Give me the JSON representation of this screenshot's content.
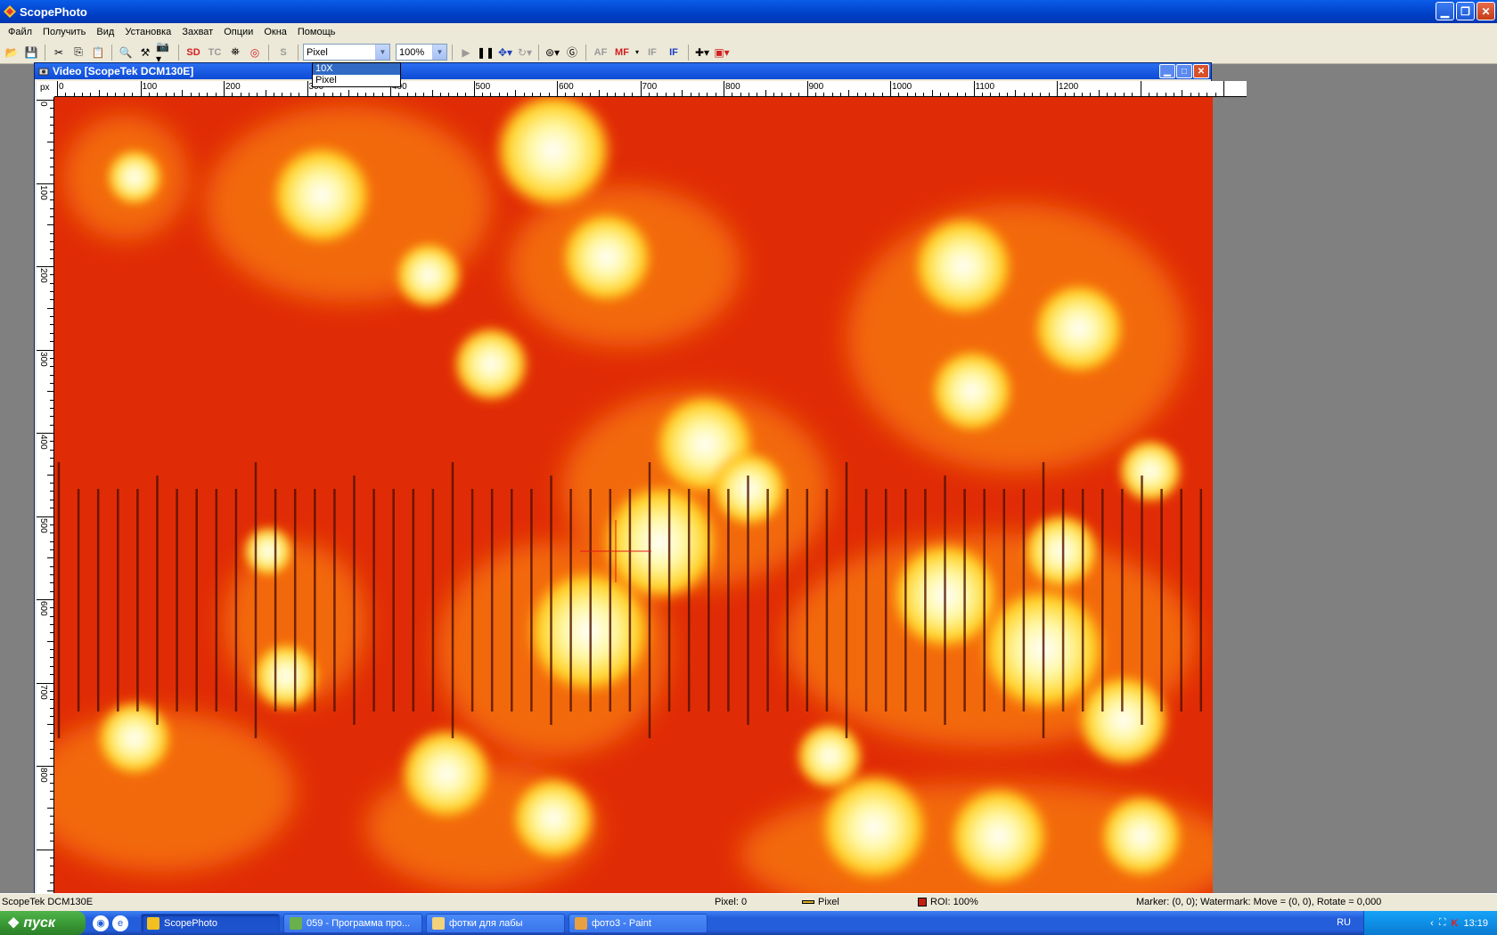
{
  "app": {
    "title": "ScopePhoto"
  },
  "menu": [
    "Файл",
    "Получить",
    "Вид",
    "Установка",
    "Захват",
    "Опции",
    "Окна",
    "Помощь"
  ],
  "toolbar": {
    "sd_label": "SD",
    "tc_label": "TC",
    "s_label": "S",
    "af_label": "AF",
    "mf_label": "MF",
    "if1_label": "IF",
    "if2_label": "IF",
    "units_value": "Pixel",
    "zoom_value": "100%"
  },
  "dropdown": {
    "options": [
      "10X",
      "Pixel"
    ],
    "selected_index": 0
  },
  "child_window": {
    "title": "Video [ScopeTek DCM130E]",
    "ruler_unit": "px",
    "ruler_top_ticks": [
      "0",
      "100",
      "200",
      "300",
      "400",
      "500",
      "600",
      "700",
      "800",
      "900",
      "1000",
      "1100",
      "1200"
    ],
    "ruler_left_ticks": [
      "0",
      "100",
      "200",
      "300",
      "400",
      "500",
      "600",
      "700",
      "800"
    ]
  },
  "status": {
    "device": "ScopeTek DCM130E",
    "pixel": "Pixel: 0",
    "unit": "Pixel",
    "roi": "ROI: 100%",
    "marker": "Marker: (0, 0); Watermark: Move = (0, 0), Rotate = 0,000"
  },
  "taskbar": {
    "start_label": "пуск",
    "tasks": [
      "ScopePhoto",
      "059 - Программа про...",
      "фотки для лабы",
      "фото3 - Paint"
    ],
    "lang": "RU",
    "clock": "13:19"
  },
  "colors": {
    "titlebar": "#0a5ce8",
    "taskbar": "#245edb",
    "sample_red": "#e03008",
    "sample_yellow": "#ffe040"
  }
}
